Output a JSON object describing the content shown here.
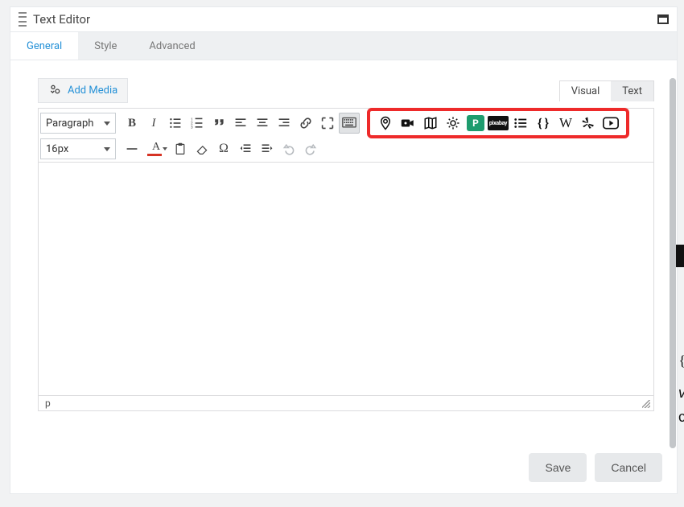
{
  "header": {
    "title": "Text Editor"
  },
  "tabs": {
    "general": "General",
    "style": "Style",
    "advanced": "Advanced",
    "active": "general"
  },
  "media": {
    "add_label": "Add Media"
  },
  "mode_tabs": {
    "visual": "Visual",
    "text": "Text",
    "active": "visual"
  },
  "format_dropdown": "Paragraph",
  "fontsize_dropdown": "16px",
  "status_path": "p",
  "buttons": {
    "save": "Save",
    "cancel": "Cancel"
  },
  "outside_text": {
    "brace": "{",
    "v": "v",
    "c": "c"
  },
  "highlight_badges": {
    "green": "P",
    "black": "pixabay"
  },
  "icons": {
    "bold": "B",
    "italic": "I",
    "wikipedia": "W",
    "textcolor": "A",
    "braces": "{ }"
  }
}
